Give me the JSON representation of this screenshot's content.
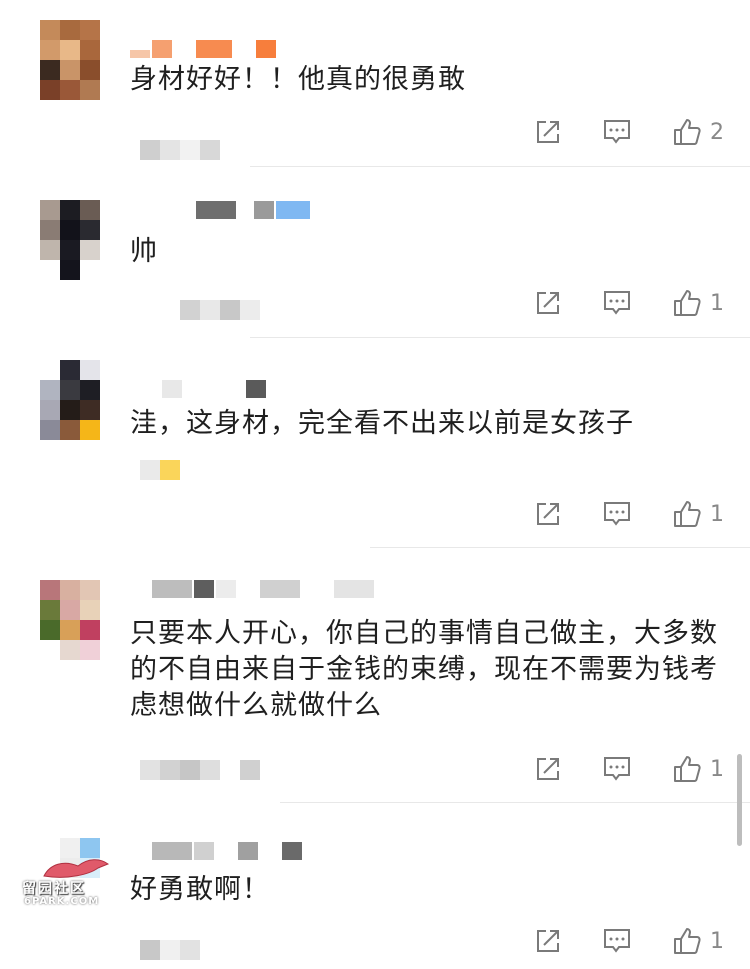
{
  "comments": [
    {
      "text": "身材好好！！他真的很勇敢",
      "like_count": "2"
    },
    {
      "text": "帅",
      "like_count": "1"
    },
    {
      "text": "洼，这身材，完全看不出来以前是女孩子",
      "like_count": "1"
    },
    {
      "text": "只要本人开心，你自己的事情自己做主，大多数的不自由来自于金钱的束缚，现在不需要为钱考虑想做什么就做什么",
      "like_count": "1"
    },
    {
      "text": "好勇敢啊！",
      "like_count": "1"
    }
  ],
  "icons": {
    "share": "share-icon",
    "reply": "comment-icon",
    "like": "thumbs-up-icon"
  },
  "watermark": {
    "text": "留园社区",
    "sub": "6PARK.COM"
  },
  "colors": {
    "text": "#1f1f1f",
    "count": "#888888",
    "icon": "#7a7a7a",
    "divider": "#e8e8e8"
  }
}
